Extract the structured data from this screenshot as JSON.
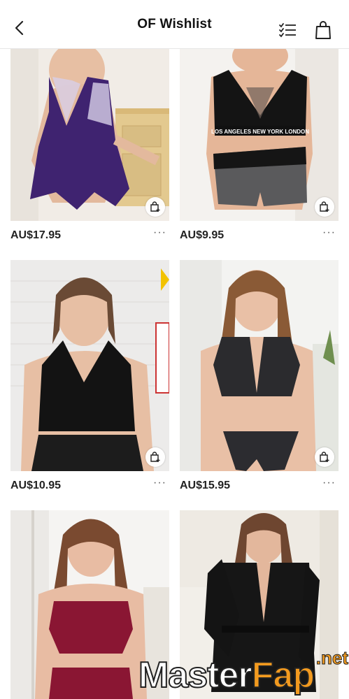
{
  "header": {
    "title": "OF Wishlist",
    "icons": [
      "back-chevron-icon",
      "checklist-icon",
      "shopping-bag-icon"
    ]
  },
  "products": [
    {
      "price": "AU$17.95",
      "more": "···",
      "cart_icon": "add-to-bag-icon"
    },
    {
      "price": "AU$9.95",
      "more": "···",
      "cart_icon": "add-to-bag-icon",
      "graphic_text": "LOS ANGELES NEW YORK LONDON"
    },
    {
      "price": "AU$10.95",
      "more": "···",
      "cart_icon": "add-to-bag-icon"
    },
    {
      "price": "AU$15.95",
      "more": "···",
      "cart_icon": "add-to-bag-icon"
    },
    {
      "price": "",
      "more": "",
      "cart_icon": ""
    },
    {
      "price": "",
      "more": "",
      "cart_icon": ""
    }
  ],
  "watermark": {
    "main_a": "Master",
    "main_b": "Fap",
    "suffix": ".net"
  },
  "colors": {
    "accent_watermark": "#f29a1f",
    "text": "#222222",
    "divider": "#e6e6e6"
  }
}
